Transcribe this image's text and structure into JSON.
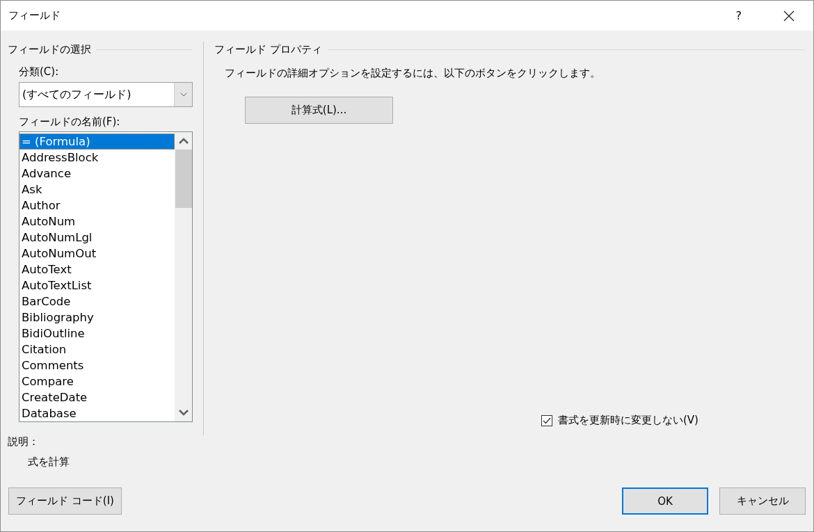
{
  "window": {
    "title": "フィールド",
    "help_button": "?"
  },
  "field_selection": {
    "heading": "フィールドの選択",
    "category_label": "分類(C):",
    "category_value": "(すべてのフィールド)",
    "names_label": "フィールドの名前(F):",
    "field_names": [
      {
        "label": "= (Formula)",
        "selected": true
      },
      {
        "label": "AddressBlock",
        "selected": false
      },
      {
        "label": "Advance",
        "selected": false
      },
      {
        "label": "Ask",
        "selected": false
      },
      {
        "label": "Author",
        "selected": false
      },
      {
        "label": "AutoNum",
        "selected": false
      },
      {
        "label": "AutoNumLgl",
        "selected": false
      },
      {
        "label": "AutoNumOut",
        "selected": false
      },
      {
        "label": "AutoText",
        "selected": false
      },
      {
        "label": "AutoTextList",
        "selected": false
      },
      {
        "label": "BarCode",
        "selected": false
      },
      {
        "label": "Bibliography",
        "selected": false
      },
      {
        "label": "BidiOutline",
        "selected": false
      },
      {
        "label": "Citation",
        "selected": false
      },
      {
        "label": "Comments",
        "selected": false
      },
      {
        "label": "Compare",
        "selected": false
      },
      {
        "label": "CreateDate",
        "selected": false
      },
      {
        "label": "Database",
        "selected": false
      }
    ]
  },
  "field_properties": {
    "heading": "フィールド プロパティ",
    "instruction": "フィールドの詳細オプションを設定するには、以下のボタンをクリックします。",
    "formula_button": "計算式(L)...",
    "preserve_formatting": {
      "label": "書式を更新時に変更しない(V)",
      "checked": true
    }
  },
  "description": {
    "label": "説明：",
    "text": "式を計算"
  },
  "buttons": {
    "field_codes": "フィールド コード(I)",
    "ok": "OK",
    "cancel": "キャンセル"
  }
}
